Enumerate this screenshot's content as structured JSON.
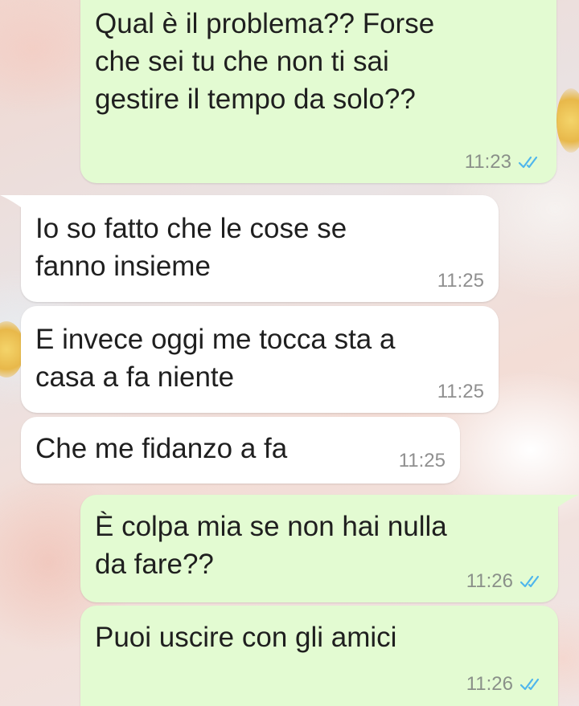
{
  "messages": [
    {
      "direction": "outgoing",
      "text": "Qual è il problema?? Forse\nche sei tu che non ti sai\ngestire il tempo da solo??",
      "time": "11:23",
      "status": "read"
    },
    {
      "direction": "incoming",
      "text": "Io so fatto che le cose se\nfanno insieme",
      "time": "11:25"
    },
    {
      "direction": "incoming",
      "text": "E invece oggi me tocca sta a\ncasa a fa niente",
      "time": "11:25"
    },
    {
      "direction": "incoming",
      "text": "Che me fidanzo a fa",
      "time": "11:25"
    },
    {
      "direction": "outgoing",
      "text": "È colpa mia se non hai nulla\nda fare??",
      "time": "11:26",
      "status": "read"
    },
    {
      "direction": "outgoing",
      "text": "Puoi uscire con gli amici",
      "time": "11:26",
      "status": "read"
    }
  ],
  "colors": {
    "outgoing_bubble": "#e3fbd2",
    "incoming_bubble": "#ffffff",
    "read_ticks": "#4fb6ec"
  },
  "icons": {
    "read_receipt": "double-check-icon"
  }
}
